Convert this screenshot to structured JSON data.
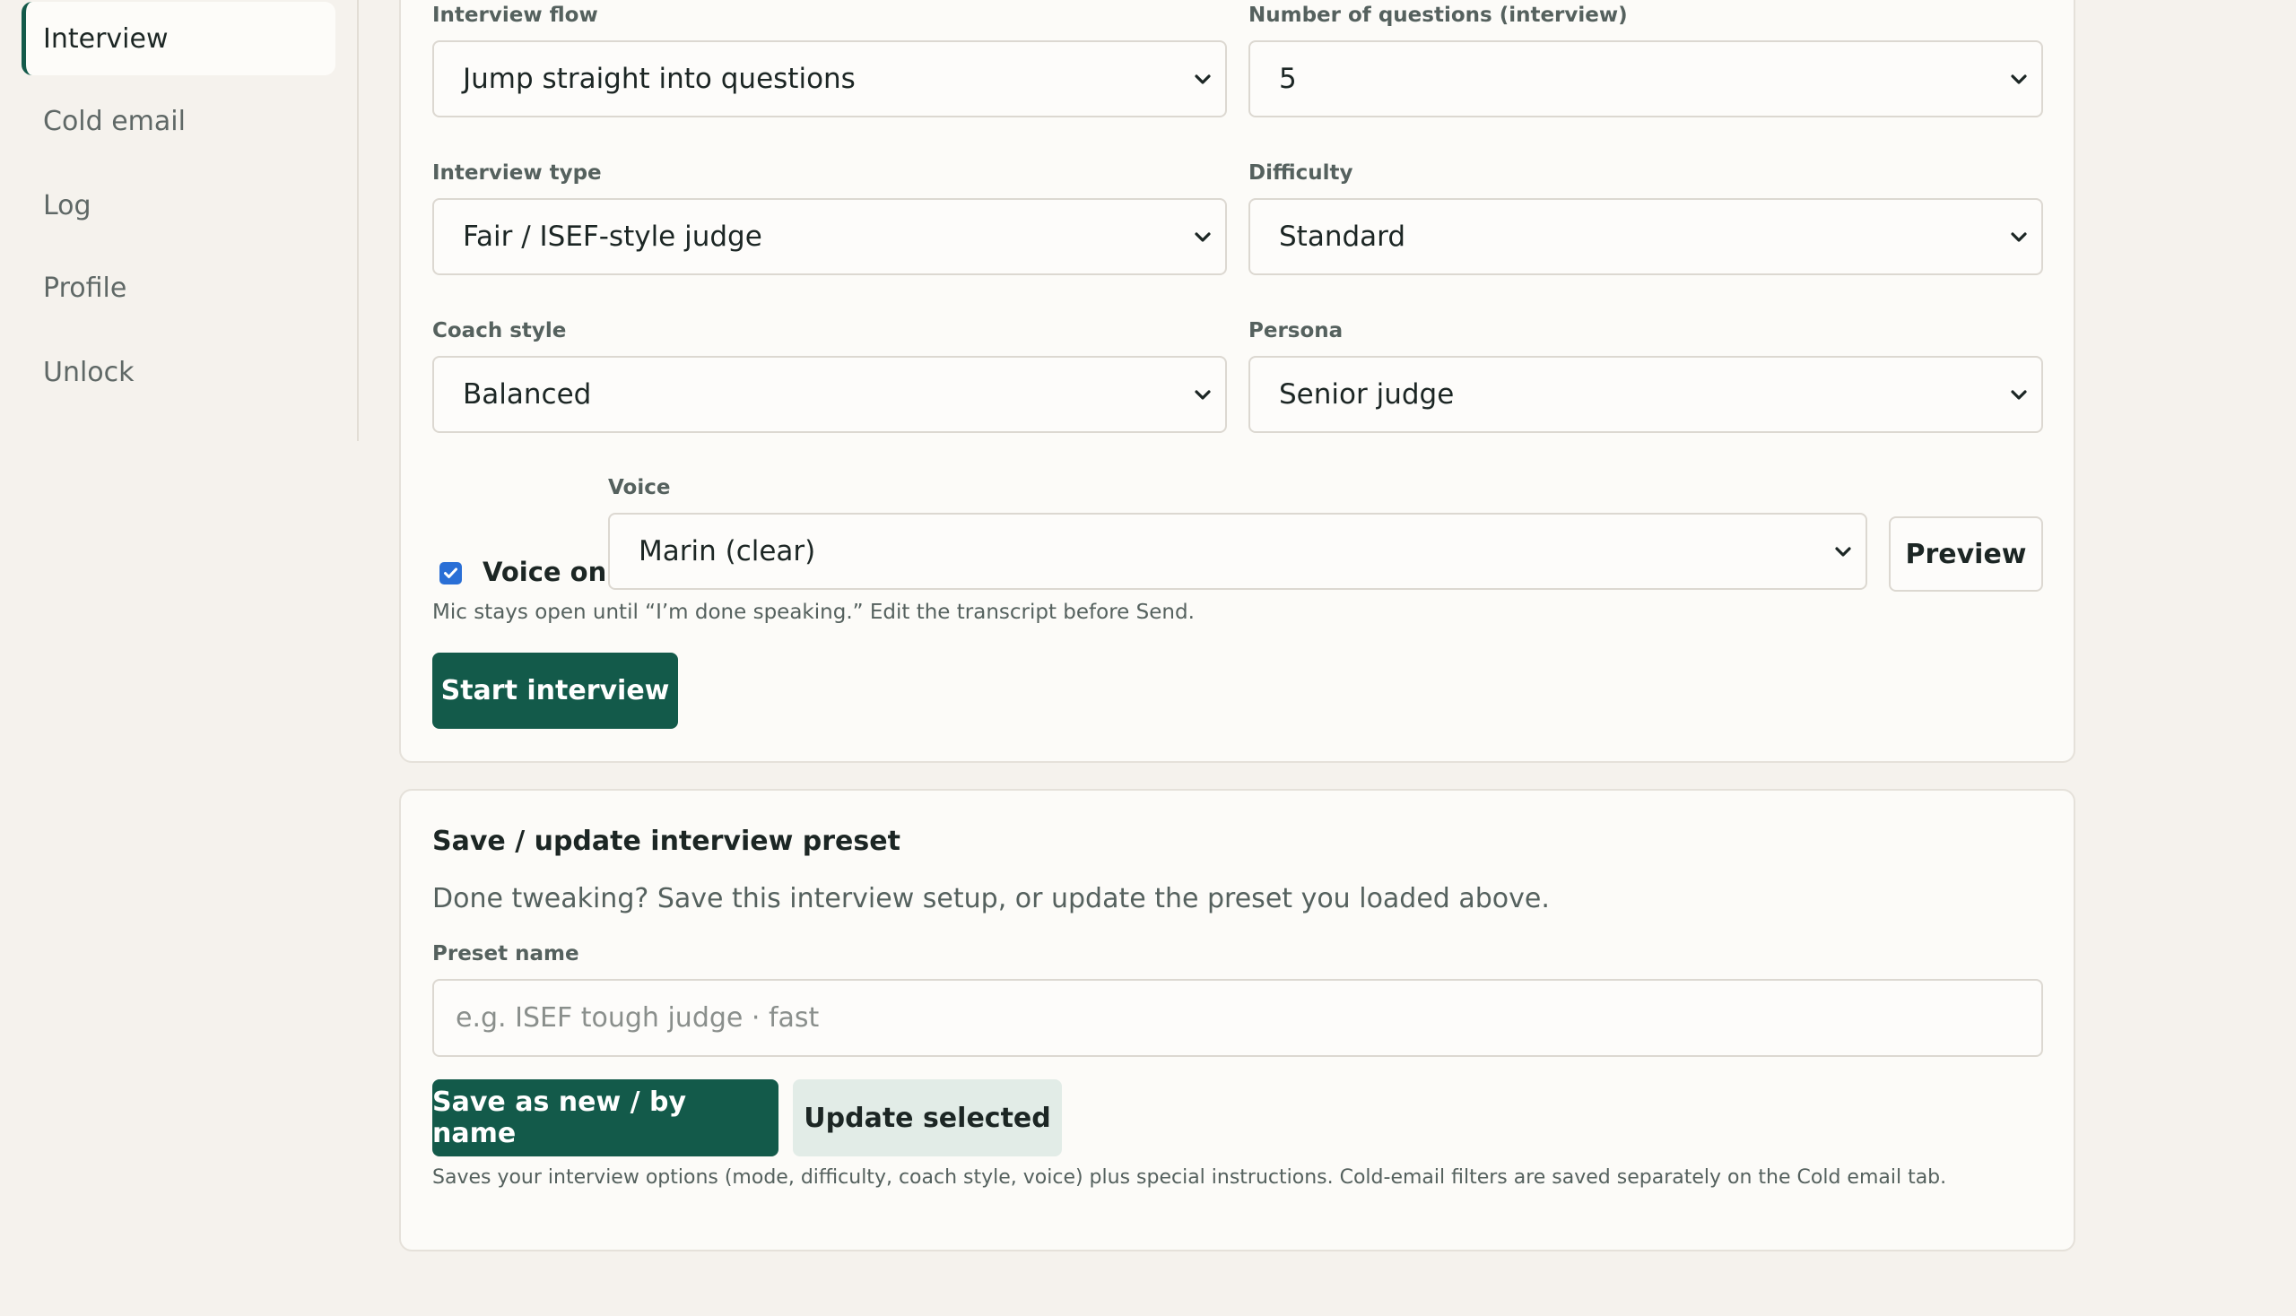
{
  "sidebar": {
    "items": [
      {
        "label": "Interview",
        "active": true
      },
      {
        "label": "Cold email"
      },
      {
        "label": "Log"
      },
      {
        "label": "Profile"
      },
      {
        "label": "Unlock"
      }
    ]
  },
  "interview_settings": {
    "flow_label": "Interview flow",
    "flow_value": "Jump straight into questions",
    "questions_label": "Number of questions (interview)",
    "questions_value": "5",
    "type_label": "Interview type",
    "type_value": "Fair / ISEF-style judge",
    "difficulty_label": "Difficulty",
    "difficulty_value": "Standard",
    "coach_label": "Coach style",
    "coach_value": "Balanced",
    "persona_label": "Persona",
    "persona_value": "Senior judge",
    "voice_on_label": "Voice on",
    "voice_on_checked": true,
    "voice_label": "Voice",
    "voice_value": "Marin (clear)",
    "preview_label": "Preview",
    "mic_hint": "Mic stays open until “I’m done speaking.” Edit the transcript before Send.",
    "start_label": "Start interview"
  },
  "preset": {
    "title": "Save / update interview preset",
    "description": "Done tweaking? Save this interview setup, or update the preset you loaded above.",
    "name_label": "Preset name",
    "name_placeholder": "e.g. ISEF tough judge · fast",
    "save_label": "Save as new / by name",
    "update_label": "Update selected",
    "footnote": "Saves your interview options (mode, difficulty, coach style, voice) plus special instructions. Cold-email filters are saved separately on the Cold email tab."
  },
  "colors": {
    "accent": "#135a4a",
    "background": "#f5f2ed",
    "card": "#fcfbf8",
    "checkbox": "#2a6fd6"
  },
  "icons": {
    "select_arrow": "chevron-down-icon",
    "checkbox_mark": "check-icon"
  }
}
